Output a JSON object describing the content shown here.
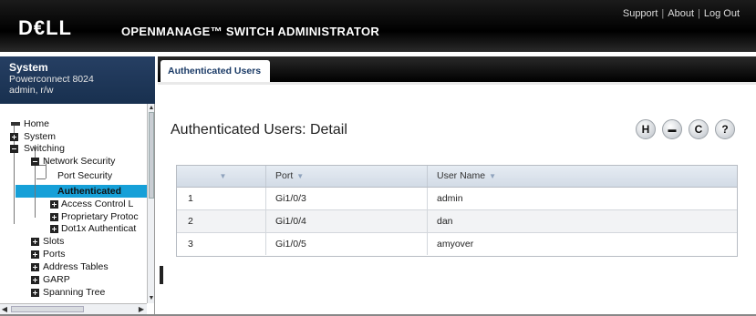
{
  "header": {
    "logo": "D€LL",
    "title": "OPENMANAGE™ SWITCH ADMINISTRATOR",
    "links": [
      "Support",
      "About",
      "Log Out"
    ]
  },
  "system": {
    "title": "System",
    "model": "Powerconnect 8024",
    "user": "admin, r/w"
  },
  "nav": {
    "items": [
      {
        "label": "Home",
        "expander": "home"
      },
      {
        "label": "System",
        "expander": "plus"
      },
      {
        "label": "Switching",
        "expander": "minus"
      },
      {
        "label": "Network Security",
        "expander": "minus"
      },
      {
        "label": "Port Security",
        "expander": "none"
      },
      {
        "label": "Authenticated",
        "expander": "none",
        "selected": true
      },
      {
        "label": "Access Control L",
        "expander": "plus"
      },
      {
        "label": "Proprietary Protoc",
        "expander": "plus"
      },
      {
        "label": "Dot1x Authenticat",
        "expander": "plus"
      },
      {
        "label": "Slots",
        "expander": "plus"
      },
      {
        "label": "Ports",
        "expander": "plus"
      },
      {
        "label": "Address Tables",
        "expander": "plus"
      },
      {
        "label": "GARP",
        "expander": "plus"
      },
      {
        "label": "Spanning Tree",
        "expander": "plus"
      }
    ],
    "selected_color": "#16a0d8"
  },
  "tab": {
    "label": "Authenticated Users"
  },
  "page": {
    "title": "Authenticated Users: Detail",
    "icons": [
      {
        "name": "save-icon",
        "glyph": "H"
      },
      {
        "name": "print-icon",
        "glyph": "▬"
      },
      {
        "name": "refresh-icon",
        "glyph": "C"
      },
      {
        "name": "help-icon",
        "glyph": "?"
      }
    ]
  },
  "table": {
    "columns": [
      "",
      "Port",
      "User Name"
    ],
    "rows": [
      [
        "1",
        "Gi1/0/3",
        "admin"
      ],
      [
        "2",
        "Gi1/0/4",
        "dan"
      ],
      [
        "3",
        "Gi1/0/5",
        "amyover"
      ]
    ]
  }
}
